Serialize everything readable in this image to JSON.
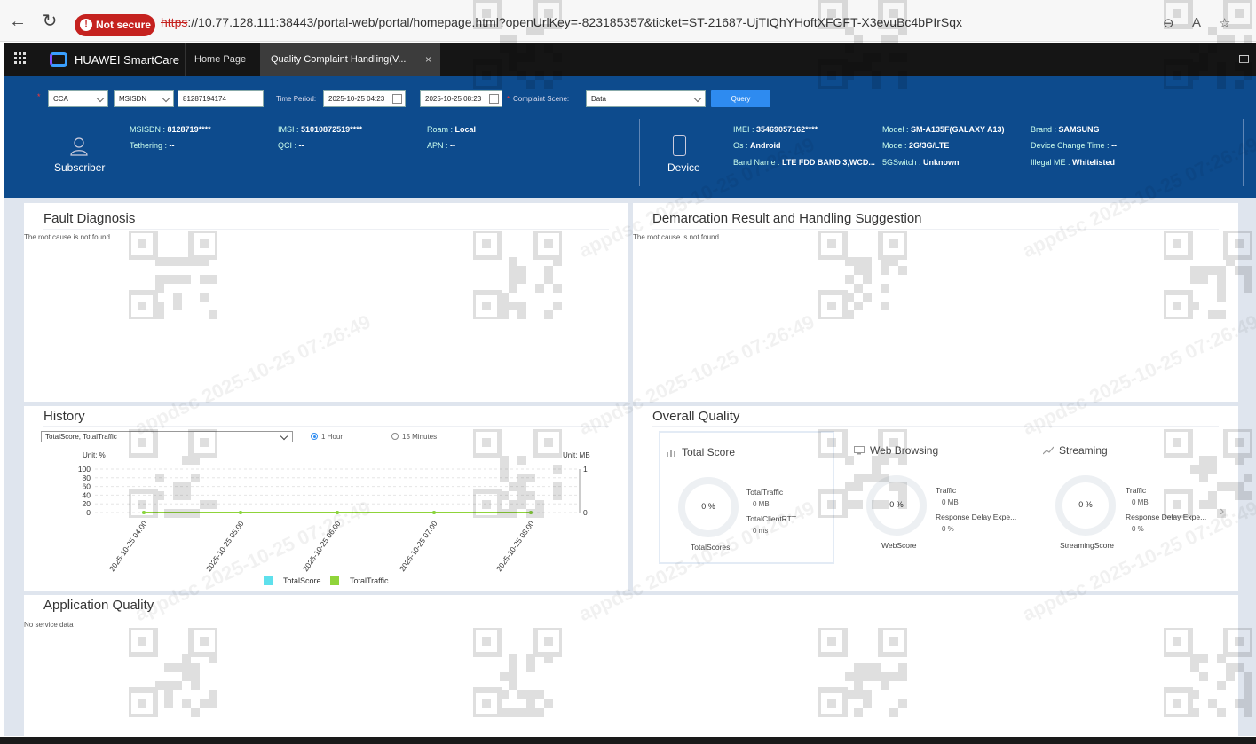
{
  "browser": {
    "not_secure": "Not secure",
    "url_scheme": "https",
    "url_rest": "://10.77.128.111:38443/portal-web/portal/homepage.html?openUrlKey=-823185357&ticket=ST-21687-UjTIQhYHoftXFGFT-X3evuBc4bPIrSqx"
  },
  "app": {
    "brand": "HUAWEI SmartCare",
    "tabs": [
      "Home Page",
      "Quality Complaint Handling(V..."
    ],
    "tab_close": "×"
  },
  "query": {
    "type": "CCA",
    "id_type": "MSISDN",
    "msisdn": "81287194174",
    "time_period_label": "Time Period:",
    "start": "2025-10-25 04:23",
    "end": "2025-10-25 08:23",
    "scene_label": "Complaint Scene:",
    "scene": "Data",
    "button": "Query",
    "required": "*"
  },
  "subscriber": {
    "label": "Subscriber",
    "fields": [
      {
        "k": "MSISDN",
        "v": "8128719****"
      },
      {
        "k": "Tethering",
        "v": "--"
      },
      {
        "k": "IMSI",
        "v": "51010872519****"
      },
      {
        "k": "QCI",
        "v": "--"
      },
      {
        "k": "Roam",
        "v": "Local"
      },
      {
        "k": "APN",
        "v": "--"
      }
    ]
  },
  "device": {
    "label": "Device",
    "fields": [
      {
        "k": "IMEI",
        "v": "35469057162****"
      },
      {
        "k": "Os",
        "v": "Android"
      },
      {
        "k": "Band Name",
        "v": "LTE FDD BAND 3,WCD..."
      },
      {
        "k": "Model",
        "v": "SM-A135F(GALAXY A13)"
      },
      {
        "k": "Mode",
        "v": "2G/3G/LTE"
      },
      {
        "k": "5GSwitch",
        "v": "Unknown"
      },
      {
        "k": "Brand",
        "v": "SAMSUNG"
      },
      {
        "k": "Device Change Time",
        "v": "--"
      },
      {
        "k": "Illegal ME",
        "v": "Whitelisted"
      }
    ]
  },
  "fault": {
    "title": "Fault Diagnosis",
    "note": "The root cause is not found"
  },
  "demarcation": {
    "title": "Demarcation Result and Handling Suggestion",
    "note": "The root cause is not found"
  },
  "history": {
    "title": "History",
    "select": "TotalScore, TotalTraffic",
    "radio_1h": "1 Hour",
    "radio_15m": "15 Minutes",
    "unit_left": "Unit: %",
    "unit_right": "Unit: MB"
  },
  "chart_data": {
    "type": "line",
    "x": [
      "2025-10-25 04:00",
      "2025-10-25 05:00",
      "2025-10-25 06:00",
      "2025-10-25 07:00",
      "2025-10-25 08:00"
    ],
    "series": [
      {
        "name": "TotalScore",
        "values": [
          0,
          0,
          0,
          0,
          0
        ],
        "axis": "left",
        "color": "#5ee0ec"
      },
      {
        "name": "TotalTraffic",
        "values": [
          0,
          0,
          0,
          0,
          0
        ],
        "axis": "right",
        "color": "#8fd43a"
      }
    ],
    "yticks_left": [
      "100",
      "80",
      "60",
      "40",
      "20",
      "0"
    ],
    "yticks_right": [
      "1",
      "0"
    ],
    "ylim_left": [
      0,
      100
    ],
    "ylim_right": [
      0,
      1
    ],
    "legend": "bottom"
  },
  "overall": {
    "title": "Overall Quality",
    "cards": [
      {
        "name": "Total Score",
        "value": "0 %",
        "k1": "TotalTraffic",
        "v1": "0 MB",
        "k2": "TotalClientRTT",
        "v2": "0 ms",
        "foot": "TotalScores",
        "fill": 0
      },
      {
        "name": "Web Browsing",
        "value": "0 %",
        "k1": "Traffic",
        "v1": "0 MB",
        "k2": "Response Delay Expe...",
        "v2": "0 %",
        "foot": "WebScore",
        "fill": 0
      },
      {
        "name": "Streaming",
        "value": "0 %",
        "k1": "Traffic",
        "v1": "0 MB",
        "k2": "Response Delay Expe...",
        "v2": "0 %",
        "foot": "StreamingScore",
        "fill": 0
      }
    ]
  },
  "application": {
    "title": "Application Quality",
    "note": "No service data"
  },
  "watermark": "appdsc 2025-10-25 07:26:49"
}
